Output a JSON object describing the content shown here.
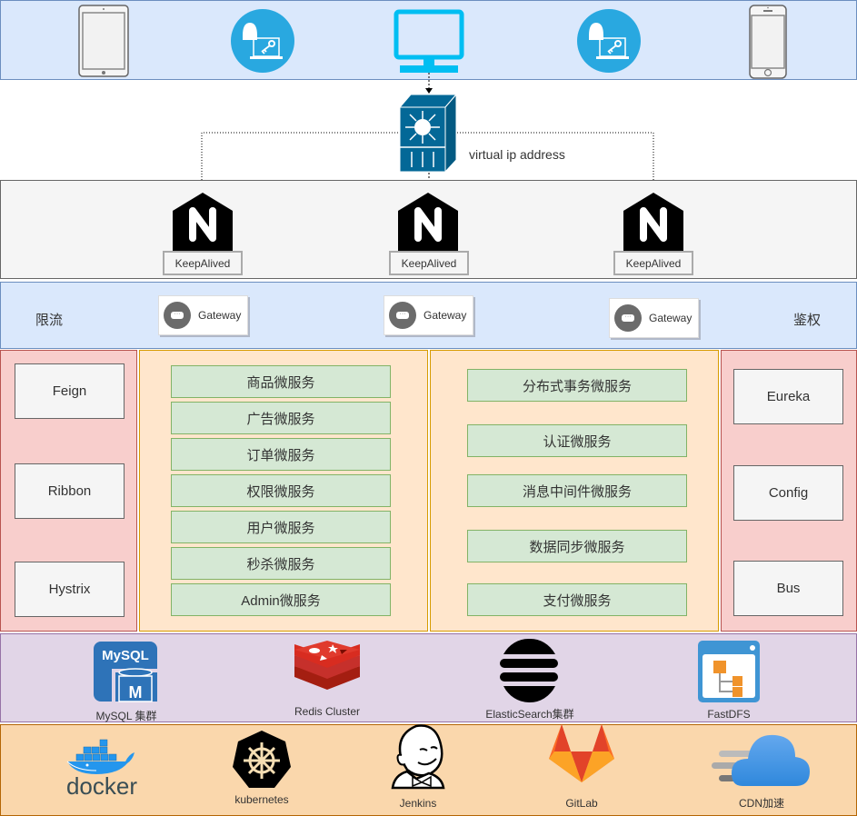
{
  "clients": {
    "icons": [
      "tablet-icon",
      "user-key-icon",
      "monitor-icon",
      "user-key-icon",
      "phone-icon"
    ]
  },
  "load_balancer": {
    "icon": "layer3-switch-icon",
    "label": "virtual ip address"
  },
  "nginx_layer": {
    "nodes": [
      {
        "icon": "nginx-icon",
        "label": "KeepAlived"
      },
      {
        "icon": "nginx-icon",
        "label": "KeepAlived"
      },
      {
        "icon": "nginx-icon",
        "label": "KeepAlived"
      }
    ]
  },
  "gateway_layer": {
    "left_label": "限流",
    "right_label": "鉴权",
    "gateways": [
      {
        "icon": "gateway-icon",
        "label": "Gateway"
      },
      {
        "icon": "gateway-icon",
        "label": "Gateway"
      },
      {
        "icon": "gateway-icon",
        "label": "Gateway"
      }
    ]
  },
  "left_components": [
    "Feign",
    "Ribbon",
    "Hystrix"
  ],
  "services_a": [
    "商品微服务",
    "广告微服务",
    "订单微服务",
    "权限微服务",
    "用户微服务",
    "秒杀微服务",
    "Admin微服务"
  ],
  "services_b": [
    "分布式事务微服务",
    "认证微服务",
    "消息中间件微服务",
    "数据同步微服务",
    "支付微服务"
  ],
  "right_components": [
    "Eureka",
    "Config",
    "Bus"
  ],
  "data_layer": {
    "items": [
      {
        "icon": "mysql-icon",
        "label": "MySQL 集群"
      },
      {
        "icon": "redis-icon",
        "label": "Redis Cluster"
      },
      {
        "icon": "elasticsearch-icon",
        "label": "ElasticSearch集群"
      },
      {
        "icon": "fastdfs-icon",
        "label": "FastDFS"
      }
    ]
  },
  "infra_layer": {
    "items": [
      {
        "icon": "docker-icon",
        "label": "docker"
      },
      {
        "icon": "kubernetes-icon",
        "label": "kubernetes"
      },
      {
        "icon": "jenkins-icon",
        "label": "Jenkins"
      },
      {
        "icon": "gitlab-icon",
        "label": "GitLab"
      },
      {
        "icon": "cdn-cloud-icon",
        "label": "CDN加速"
      }
    ]
  },
  "colors": {
    "client_blue": "#29a8e0",
    "monitor_cyan": "#00bef2",
    "switch_blue": "#036897",
    "layer_blue": "#dae8fc",
    "service_green": "#d5e8d4",
    "orange_fill": "#ffe6cc",
    "red_fill": "#f8cecc",
    "purple_fill": "#e1d5e7",
    "infra_fill": "#fad7ac"
  }
}
